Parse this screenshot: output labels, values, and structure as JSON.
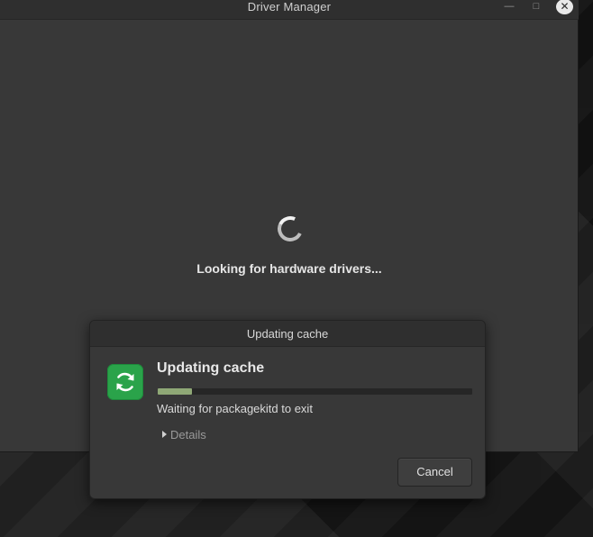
{
  "window": {
    "title": "Driver Manager",
    "minimize_glyph": "—",
    "maximize_glyph": "□",
    "close_glyph": "✕"
  },
  "main": {
    "status": "Looking for hardware drivers..."
  },
  "dialog": {
    "title": "Updating cache",
    "heading": "Updating cache",
    "progress_fraction": 0.11,
    "status": "Waiting for packagekitd to exit",
    "details_label": "Details",
    "cancel_label": "Cancel",
    "icon": "refresh-icon"
  },
  "colors": {
    "accent_green": "#2aa34a",
    "progress": "#8fa876"
  }
}
